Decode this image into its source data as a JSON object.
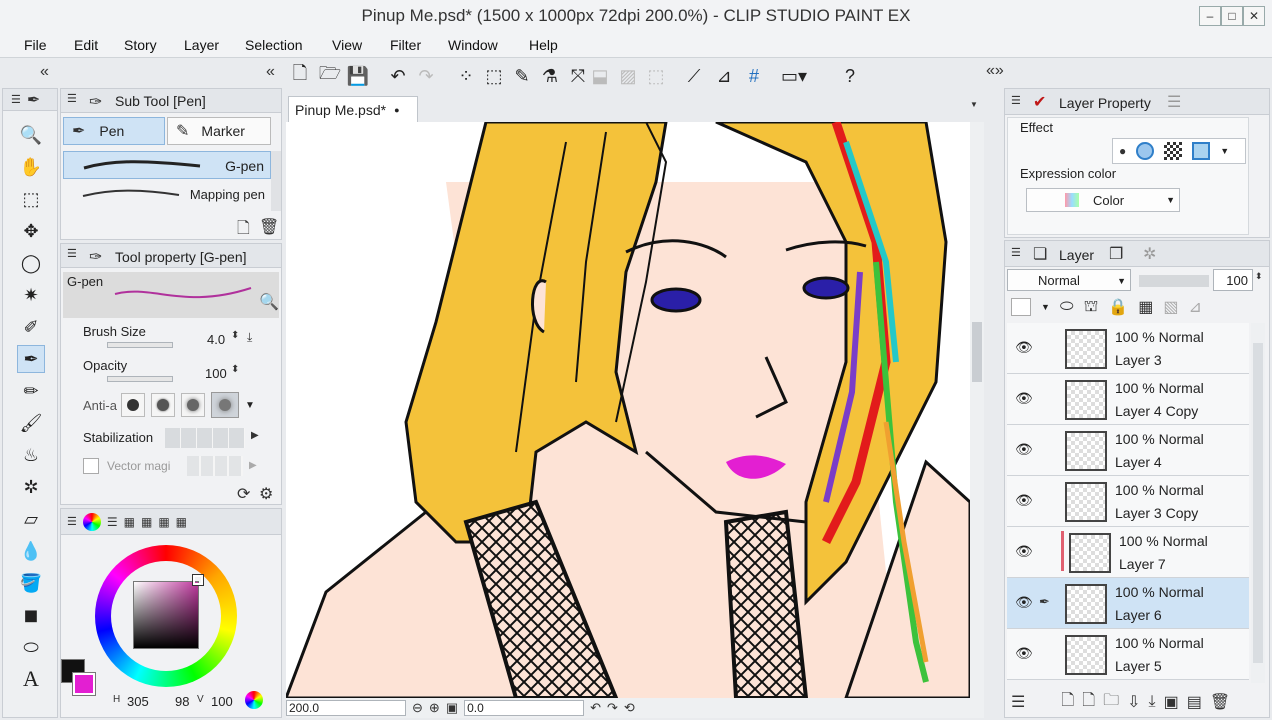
{
  "window": {
    "title": "Pinup Me.psd* (1500 x 1000px 72dpi 200.0%) - CLIP STUDIO PAINT EX",
    "min": "–",
    "max": "□",
    "close": "✕"
  },
  "menu": [
    "File",
    "Edit",
    "Story",
    "Layer",
    "Selection",
    "View",
    "Filter",
    "Window",
    "Help"
  ],
  "subtool": {
    "title": "Sub Tool [Pen]",
    "tabs": [
      "Pen",
      "Marker"
    ],
    "items": [
      "G-pen",
      "Mapping pen"
    ]
  },
  "toolprop": {
    "title": "Tool property [G-pen]",
    "preview_label": "G-pen",
    "brush_size_label": "Brush Size",
    "brush_size": "4.0",
    "opacity_label": "Opacity",
    "opacity": "100",
    "anti_label": "Anti-a",
    "stabilization_label": "Stabilization",
    "vector_label": "Vector magi"
  },
  "color": {
    "main": "#111111",
    "sub": "#e31fd2",
    "h": "305",
    "s": "98",
    "v": "100",
    "hue_accent": "#c0399f"
  },
  "canvas": {
    "tab": "Pinup Me.psd*",
    "zoom": "200.0",
    "rotation": "0.0"
  },
  "layer_property": {
    "title": "Layer Property",
    "effect_label": "Effect",
    "expression_label": "Expression color",
    "expression_value": "Color"
  },
  "layer_panel": {
    "title": "Layer",
    "blend_mode": "Normal",
    "opacity": "100",
    "layers": [
      {
        "opacity": "100 %",
        "mode": "Normal",
        "name": "Layer 3",
        "selected": false
      },
      {
        "opacity": "100 %",
        "mode": "Normal",
        "name": "Layer 4 Copy",
        "selected": false
      },
      {
        "opacity": "100 %",
        "mode": "Normal",
        "name": "Layer 4",
        "selected": false
      },
      {
        "opacity": "100 %",
        "mode": "Normal",
        "name": "Layer 3 Copy",
        "selected": false
      },
      {
        "opacity": "100 %",
        "mode": "Normal",
        "name": "Layer 7",
        "selected": false
      },
      {
        "opacity": "100 %",
        "mode": "Normal",
        "name": "Layer 6",
        "selected": true
      },
      {
        "opacity": "100 %",
        "mode": "Normal",
        "name": "Layer 5",
        "selected": false
      }
    ]
  }
}
